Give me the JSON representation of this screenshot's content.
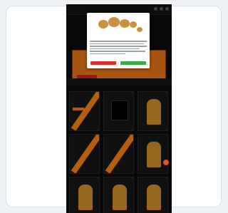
{
  "site": {
    "logo_text": "",
    "accent_color": "#f07f10",
    "background_color": "#0b0b0b"
  },
  "hero": {
    "title": "",
    "cta_color": "#c9261f"
  },
  "tiles": [
    {
      "caption": "",
      "kind": "promo"
    },
    {
      "caption": "",
      "kind": "shirt"
    },
    {
      "caption": "",
      "kind": "person"
    },
    {
      "caption": "",
      "kind": "promo"
    },
    {
      "caption": "",
      "kind": "promo"
    },
    {
      "caption": "",
      "kind": "person"
    },
    {
      "caption": "",
      "kind": "person"
    },
    {
      "caption": "",
      "kind": "person"
    },
    {
      "caption": "",
      "kind": "person"
    }
  ],
  "cookie_modal": {
    "title": "",
    "decline_color": "#d8322c",
    "accept_color": "#3aa84a"
  },
  "icons": {
    "chat": "chat-bubble-icon"
  }
}
